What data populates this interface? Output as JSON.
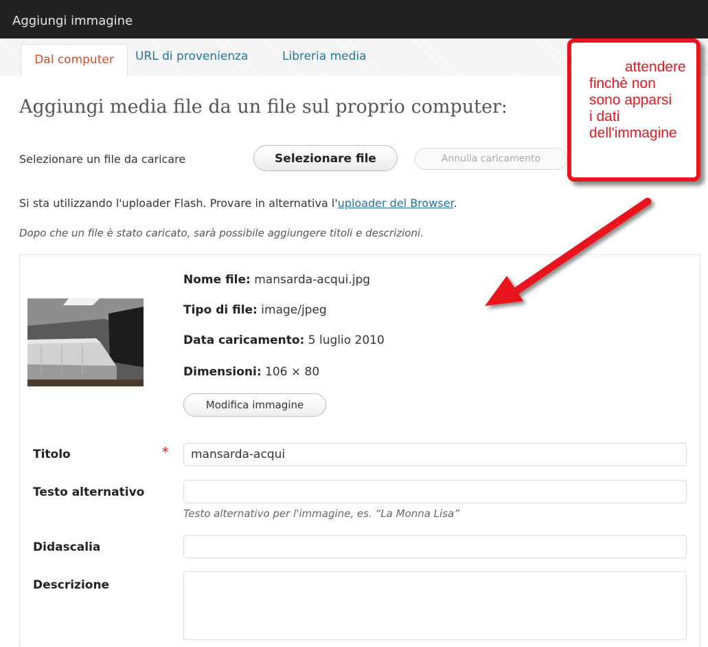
{
  "window": {
    "title": "Aggiungi immagine"
  },
  "tabs": [
    {
      "label": "Dal computer",
      "active": true
    },
    {
      "label": "URL di provenienza",
      "active": false
    },
    {
      "label": "Libreria media",
      "active": false
    }
  ],
  "upload": {
    "heading": "Aggiungi media file da un file sul proprio computer:",
    "select_label": "Selezionare un file da caricare",
    "select_button": "Selezionare file",
    "cancel_button": "Annulla caricamento",
    "flash_text_prefix": "Si sta utilizzando l'uploader Flash. Provare in alternativa l'",
    "flash_link": "uploader del Browser",
    "flash_text_suffix": ".",
    "note": "Dopo che un file è stato caricato, sarà possibile aggiungere titoli e descrizioni."
  },
  "file_info": {
    "name_label": "Nome file:",
    "name_value": "mansarda-acqui.jpg",
    "type_label": "Tipo di file:",
    "type_value": "image/jpeg",
    "date_label": "Data caricamento:",
    "date_value": "5 luglio 2010",
    "dim_label": "Dimensioni:",
    "dim_value": "106 × 80",
    "edit_button": "Modifica immagine"
  },
  "form": {
    "title_label": "Titolo",
    "required_mark": "*",
    "title_value": "mansarda-acqui",
    "alt_label": "Testo alternativo",
    "alt_value": "",
    "alt_help": "Testo alternativo per l'immagine, es. “La Monna Lisa”",
    "caption_label": "Didascalia",
    "caption_value": "",
    "desc_label": "Descrizione",
    "desc_value": ""
  },
  "callout": {
    "lines": [
      "attendere",
      "finchè non",
      "sono apparsi",
      "i dati",
      "dell'immagine"
    ],
    "color": "#e8151d"
  },
  "colors": {
    "link": "#21759b",
    "active_tab": "#d54e21",
    "titlebar": "#222222"
  }
}
